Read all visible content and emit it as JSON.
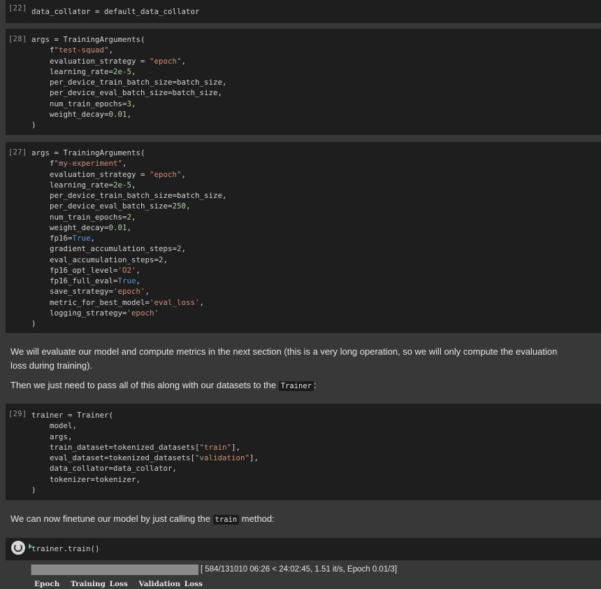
{
  "cells": [
    {
      "exec": "[22]",
      "lines": [
        "data_collator = default_data_collator"
      ]
    },
    {
      "exec": "[28]",
      "lines": [
        "args = TrainingArguments(",
        "    f\"test-squad\",",
        "    evaluation_strategy = \"epoch\",",
        "    learning_rate=2e-5,",
        "    per_device_train_batch_size=batch_size,",
        "    per_device_eval_batch_size=batch_size,",
        "    num_train_epochs=3,",
        "    weight_decay=0.01,",
        ")"
      ]
    },
    {
      "exec": "[27]",
      "lines": [
        "args = TrainingArguments(",
        "    f\"my-experiment\",",
        "    evaluation_strategy = \"epoch\",",
        "    learning_rate=2e-5,",
        "    per_device_train_batch_size=batch_size,",
        "    per_device_eval_batch_size=250,",
        "    num_train_epochs=2,",
        "    weight_decay=0.01,",
        "    fp16=True,",
        "    gradient_accumulation_steps=2,",
        "    eval_accumulation_steps=2,",
        "    fp16_opt_level='O2',",
        "    fp16_full_eval=True,",
        "    save_strategy='epoch',",
        "    metric_for_best_model='eval_loss',",
        "    logging_strategy='epoch'",
        ")"
      ]
    },
    {
      "exec": "[29]",
      "lines": [
        "trainer = Trainer(",
        "    model,",
        "    args,",
        "    train_dataset=tokenized_datasets[\"train\"],",
        "    eval_dataset=tokenized_datasets[\"validation\"],",
        "    data_collator=data_collator,",
        "    tokenizer=tokenizer,",
        ")"
      ]
    },
    {
      "exec": "",
      "lines": [
        "trainer.train()"
      ]
    }
  ],
  "markdown1": {
    "p1": "We will evaluate our model and compute metrics in the next section (this is a very long operation, so we will only compute the evaluation loss during training).",
    "p2_before": "Then we just need to pass all of this along with our datasets to the ",
    "p2_code": "Trainer",
    "p2_after": ":"
  },
  "markdown2": {
    "before": "We can now finetune our model by just calling the ",
    "code": "train",
    "after": " method:"
  },
  "progress": {
    "fraction": 0.0045,
    "text": "[ 584/131010 06:26 < 24:02:45, 1.51 it/s, Epoch 0.01/3]"
  },
  "table_headers": [
    "Epoch",
    "Training Loss",
    "Validation Loss"
  ],
  "colors": {
    "string": "#ce9178",
    "number": "#b5cea8",
    "keyword": "#569cd6"
  }
}
